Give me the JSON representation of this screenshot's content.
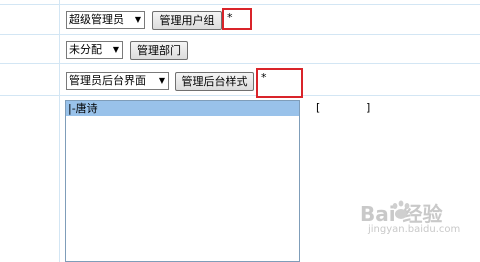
{
  "row1": {
    "role_select": "超级管理员",
    "manage_group_button": "管理用户组",
    "required_mark": "*"
  },
  "row2": {
    "dept_select": "未分配",
    "manage_dept_button": "管理部门"
  },
  "row3": {
    "ui_select": "管理员后台界面",
    "manage_style_button": "管理后台样式",
    "required_mark": "*"
  },
  "category_list": {
    "items": [
      "|-唐诗"
    ]
  },
  "bracket": {
    "left": "[",
    "right": "]"
  },
  "watermark": {
    "main": "Bai 经验",
    "sub": "jingyan.baidu.com"
  },
  "colors": {
    "highlight_border": "#d9242a",
    "selected_item": "#99c2ea",
    "grid_line": "#d3e6f4"
  }
}
